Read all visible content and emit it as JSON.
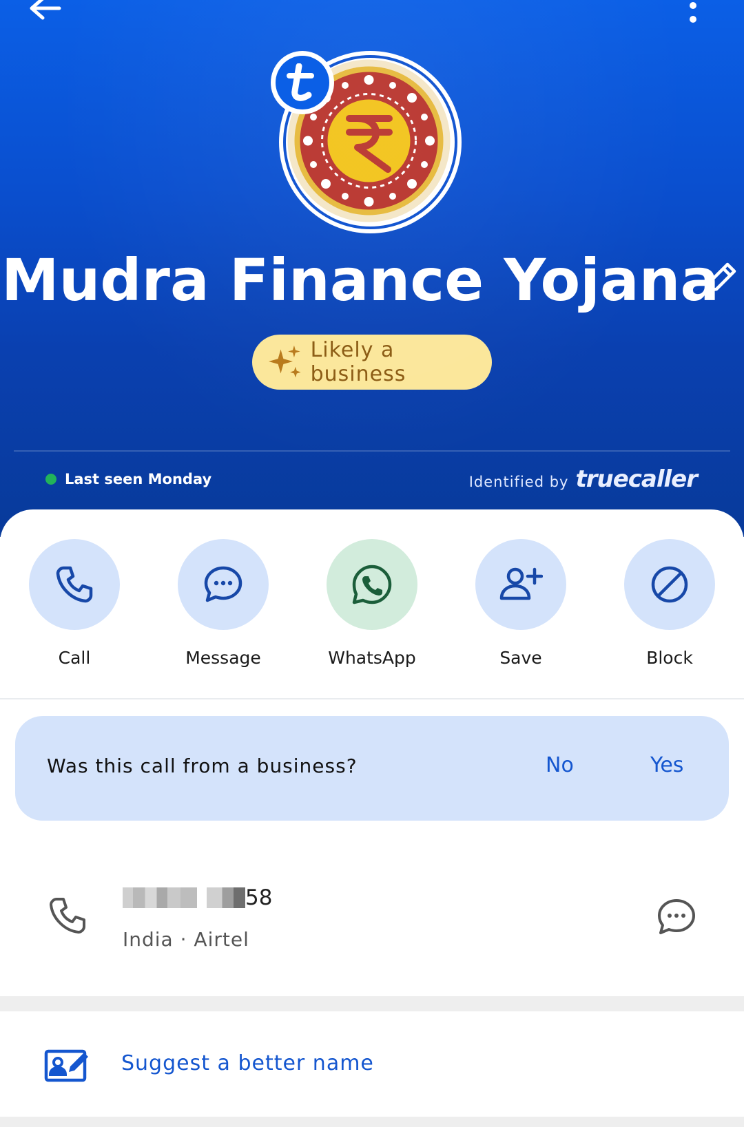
{
  "header": {
    "contact_name": "Mudra Finance Yojana",
    "badge_label": "Likely a business",
    "last_seen": "Last seen Monday",
    "identified_prefix": "Identified by",
    "identified_brand": "truecaller"
  },
  "actions": [
    {
      "label": "Call",
      "icon": "phone-icon"
    },
    {
      "label": "Message",
      "icon": "chat-icon"
    },
    {
      "label": "WhatsApp",
      "icon": "whatsapp-icon"
    },
    {
      "label": "Save",
      "icon": "add-contact-icon"
    },
    {
      "label": "Block",
      "icon": "block-icon"
    }
  ],
  "survey": {
    "question": "Was this call from a business?",
    "no_label": "No",
    "yes_label": "Yes"
  },
  "phone": {
    "number_suffix": "58",
    "carrier": "India · Airtel"
  },
  "suggest": {
    "label": "Suggest a better name"
  },
  "colors": {
    "hero_blue": "#0a4fcf",
    "accent_blue": "#1456cf",
    "action_circle": "#d4e3fb",
    "whatsapp_circle": "#d2ecdc",
    "badge_yellow": "#fbe79a",
    "online_green": "#22b35a"
  }
}
